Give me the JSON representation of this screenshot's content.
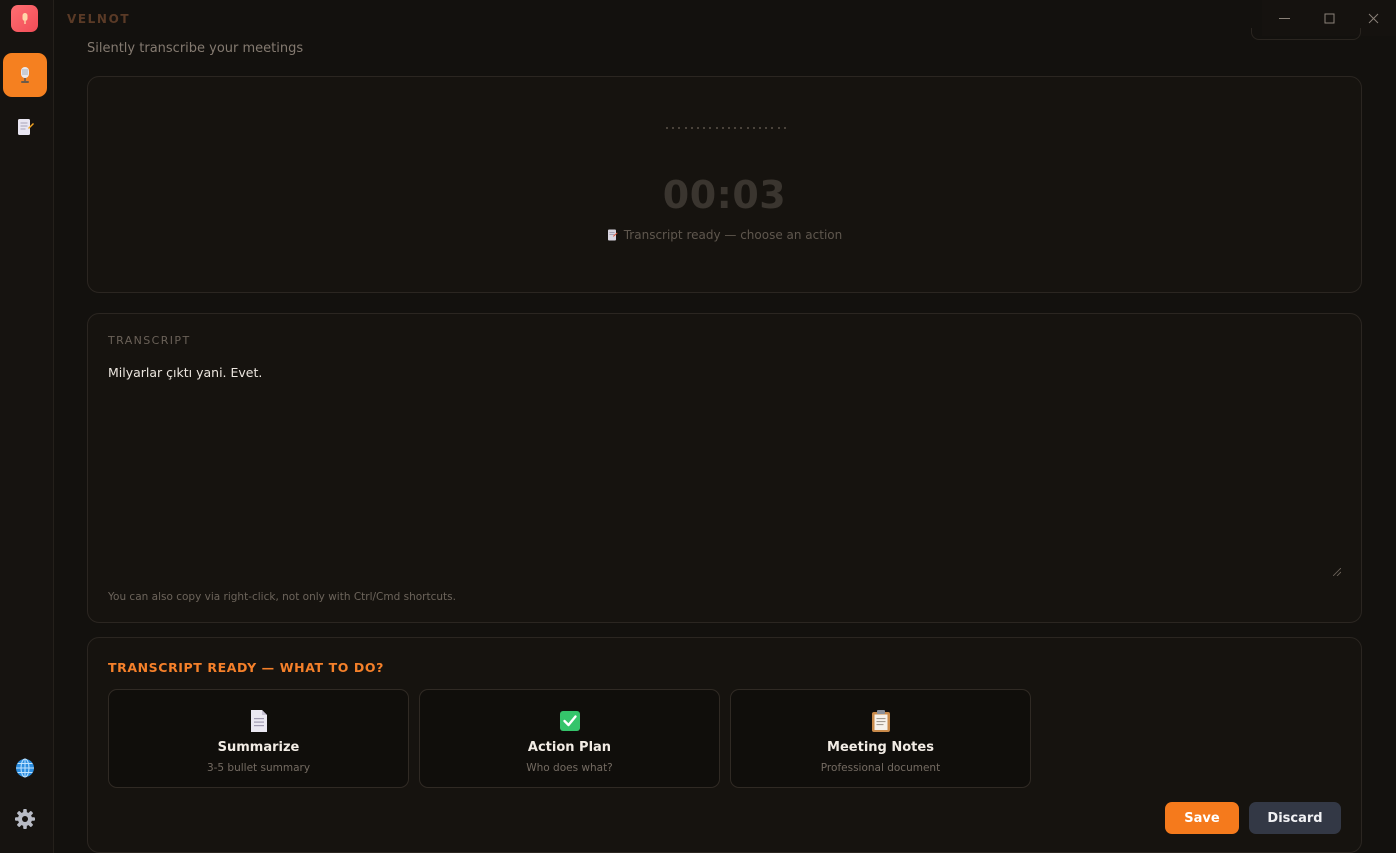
{
  "app": {
    "brand": "VELNOT",
    "subtitle": "Silently transcribe your meetings"
  },
  "sidebar": {
    "items": [
      {
        "name": "record",
        "icon": "microphone-icon",
        "active": true
      },
      {
        "name": "notes",
        "icon": "notes-icon",
        "active": false
      }
    ],
    "bottom": [
      {
        "name": "language",
        "icon": "globe-icon"
      },
      {
        "name": "settings",
        "icon": "gear-icon"
      }
    ]
  },
  "window_controls": [
    "minimize-icon",
    "maximize-icon",
    "close-icon"
  ],
  "recorder": {
    "timer": "00:03",
    "status": "Transcript ready — choose an action",
    "status_icon": "document-icon"
  },
  "transcript": {
    "label": "TRANSCRIPT",
    "text": "Milyarlar çıktı yani. Evet.",
    "hint": "You can also copy via right-click, not only with Ctrl/Cmd shortcuts."
  },
  "actions": {
    "title": "TRANSCRIPT READY — WHAT TO DO?",
    "options": [
      {
        "title": "Summarize",
        "desc": "3-5 bullet summary",
        "icon": "document-icon"
      },
      {
        "title": "Action Plan",
        "desc": "Who does what?",
        "icon": "checkmark-icon"
      },
      {
        "title": "Meeting Notes",
        "desc": "Professional document",
        "icon": "clipboard-icon"
      }
    ],
    "save_label": "Save",
    "discard_label": "Discard"
  },
  "colors": {
    "accent": "#f57a1c",
    "background": "#13110e",
    "card": "#16130f",
    "discard": "#333845",
    "logo": "#f14c57",
    "check": "#35c46b"
  }
}
